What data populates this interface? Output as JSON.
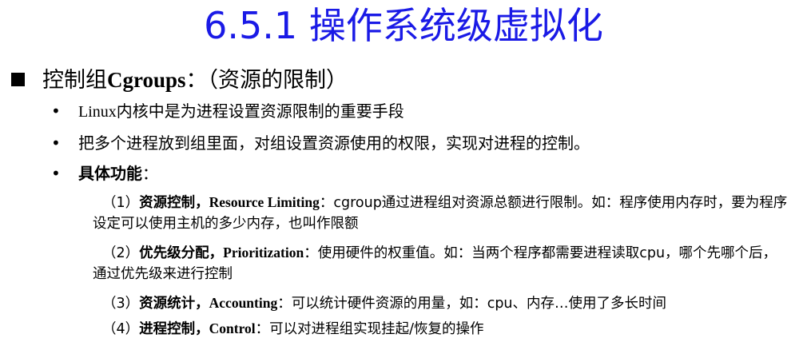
{
  "title": "6.5.1 操作系统级虚拟化",
  "heading": {
    "prefix": "控制组",
    "term": "Cgroups",
    "colon": "：",
    "paren": "（资源的限制）"
  },
  "bullets": {
    "b1_latin": "Linux",
    "b1_rest": "内核中是为进程设置资源限制的重要手段",
    "b2": "把多个进程放到组里面，对组设置资源使用的权限，实现对进程的控制。",
    "b3_label": "具体功能",
    "b3_colon": "："
  },
  "functions": [
    {
      "num": "（1）",
      "name": "资源控制，",
      "en": "Resource Limiting",
      "colon": "：",
      "desc": "cgroup通过进程组对资源总额进行限制。如：程序使用内存时，要为程序设定可以使用主机的多少内存，也叫作限额"
    },
    {
      "num": "（2）",
      "name": "优先级分配，",
      "en": "Prioritization",
      "colon": "：",
      "desc": "使用硬件的权重值。如：当两个程序都需要进程读取cpu，哪个先哪个后，通过优先级来进行控制"
    },
    {
      "num": "（3）",
      "name": "资源统计，",
      "en": "Accounting",
      "colon": "：",
      "desc": "可以统计硬件资源的用量，如：cpu、内存…使用了多长时间"
    },
    {
      "num": "（4）",
      "name": "进程控制，",
      "en": "Control",
      "colon": "：",
      "desc": "可以对进程组实现挂起/恢复的操作"
    }
  ],
  "colors": {
    "title": "#1a1ae6",
    "text": "#000000"
  }
}
